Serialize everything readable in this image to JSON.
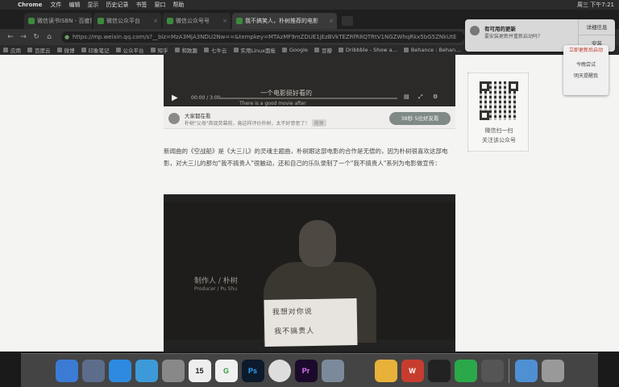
{
  "menubar": {
    "apple": "",
    "app": "Chrome",
    "menus": [
      "文件",
      "编辑",
      "显示",
      "历史记录",
      "书签",
      "窗口",
      "帮助"
    ],
    "right": [
      "周三 下午7:21"
    ]
  },
  "tabs": [
    {
      "label": "微信读书ISBN - 百度搜索"
    },
    {
      "label": "微信公众平台"
    },
    {
      "label": "微信公众号号"
    },
    {
      "label": "我不搞笑人，朴树推荐的电影"
    }
  ],
  "toolbar": {
    "url": "https://mp.weixin.qq.com/s?__biz=MzA3MjA3NDU2Nw==&tempkey=MTAzMF9mZDUE1jEzBVkTEZRfR8QTRtV1NGZWhqRkx5bG5ZNkUtE"
  },
  "bookmarks": [
    "应用",
    "百度云",
    "微博",
    "印象笔记",
    "公众平台",
    "知乎",
    "和致趣",
    "七牛云",
    "实用Linux面板",
    "Google",
    "豆瓣",
    "Dribbble - Show a...",
    "Behance : Behan..."
  ],
  "video1": {
    "caption": "一个电影挺好看的",
    "caption_en": "There is a good movie after",
    "time": "00:00 / 3:00"
  },
  "share_strip": {
    "title": "大家都在看",
    "subtitle": "朴树\"父母\"首现荧幕前，竟这样评价朴树，太不好意思了！",
    "tag": "视频",
    "button": "38秒 5位好友看"
  },
  "article": {
    "text": "新闻曲的《空战船》是《大三儿》的灵魂主题曲，朴树跟这部电影的合作是无偿的，因为朴树很喜欢这部电影，对大三儿的那句\"我不搞贵人\"很触动，还和自己的乐队录制了一个\"我不搞贵人\"系列为电影做宣传："
  },
  "video2": {
    "label": "制作人 / 朴树",
    "label_en": "Producer / Pu Shu",
    "sign_line1": "我想对你说",
    "sign_line2": "我不搞贵人"
  },
  "qr": {
    "line1": "微信扫一扫",
    "line2": "关注该公众号"
  },
  "notification": {
    "title": "有可用的更新",
    "subtitle": "要安装更新并重新启动吗？",
    "btn_details": "详细信息",
    "btn_install": "安装"
  },
  "dropdown": {
    "items": [
      "立即更新后启动",
      "今晚尝试",
      "明天提醒我"
    ]
  },
  "dock": {
    "items": [
      "Finder",
      "Launchpad",
      "App Store",
      "Safari",
      "Preview",
      "Calendar",
      "Kuaiya",
      "Ps",
      "Chrome",
      "Pr",
      "FileMerge",
      "iStat",
      "Sketch",
      "WPS",
      "QQ",
      "WeChat",
      "Coda",
      "Folder",
      "Trash"
    ],
    "calendar_day": "15"
  }
}
